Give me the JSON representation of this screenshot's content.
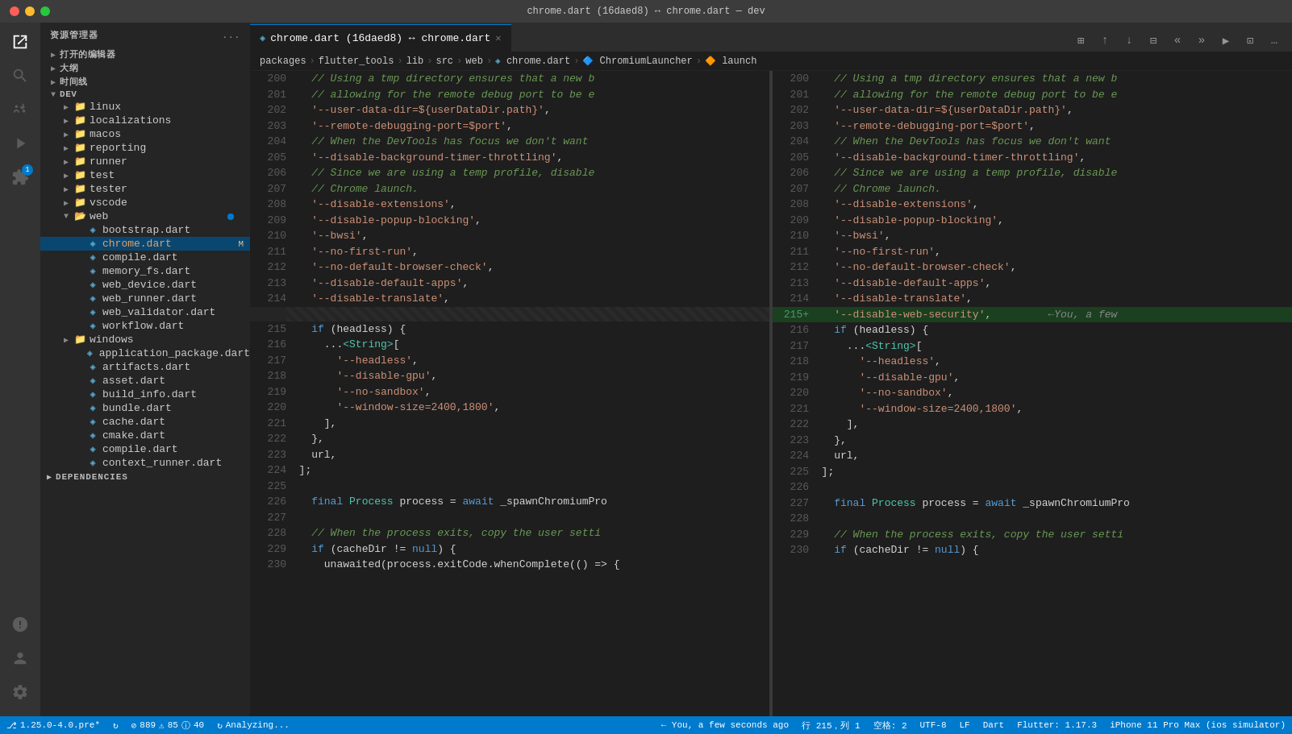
{
  "titleBar": {
    "title": "chrome.dart (16daed8) ↔ chrome.dart — dev"
  },
  "activityBar": {
    "icons": [
      {
        "name": "explorer-icon",
        "symbol": "⎗",
        "active": true,
        "badge": null
      },
      {
        "name": "search-icon",
        "symbol": "🔍",
        "active": false
      },
      {
        "name": "source-control-icon",
        "symbol": "⑂",
        "active": false
      },
      {
        "name": "run-icon",
        "symbol": "▷",
        "active": false
      },
      {
        "name": "extensions-icon",
        "symbol": "⊞",
        "active": false
      },
      {
        "name": "remote-icon",
        "symbol": "◎",
        "active": false,
        "badge": "1"
      }
    ],
    "bottomIcons": [
      {
        "name": "problems-icon",
        "symbol": "⚠"
      },
      {
        "name": "account-icon",
        "symbol": "👤"
      },
      {
        "name": "settings-icon",
        "symbol": "⚙"
      }
    ]
  },
  "sidebar": {
    "header": "资源管理器",
    "moreBtn": "...",
    "sections": [
      {
        "label": "打开的编辑器",
        "expanded": false,
        "indent": 0
      },
      {
        "label": "大纲",
        "expanded": false,
        "indent": 0
      },
      {
        "label": "时间线",
        "expanded": false,
        "indent": 0
      },
      {
        "label": "DEV",
        "expanded": true,
        "indent": 0,
        "children": [
          {
            "label": "linux",
            "type": "folder",
            "indent": 1,
            "expanded": false
          },
          {
            "label": "localizations",
            "type": "folder",
            "indent": 1,
            "expanded": false
          },
          {
            "label": "macos",
            "type": "folder",
            "indent": 1,
            "expanded": false
          },
          {
            "label": "reporting",
            "type": "folder",
            "indent": 1,
            "expanded": false
          },
          {
            "label": "runner",
            "type": "folder",
            "indent": 1,
            "expanded": false
          },
          {
            "label": "test",
            "type": "folder",
            "indent": 1,
            "expanded": false
          },
          {
            "label": "tester",
            "type": "folder",
            "indent": 1,
            "expanded": false
          },
          {
            "label": "vscode",
            "type": "folder",
            "indent": 1,
            "expanded": false
          },
          {
            "label": "web",
            "type": "folder",
            "indent": 1,
            "expanded": true,
            "dot": true,
            "children": [
              {
                "label": "bootstrap.dart",
                "type": "file",
                "indent": 2,
                "active": false
              },
              {
                "label": "chrome.dart",
                "type": "file",
                "indent": 2,
                "active": true,
                "badge": "M"
              },
              {
                "label": "compile.dart",
                "type": "file",
                "indent": 2
              },
              {
                "label": "memory_fs.dart",
                "type": "file",
                "indent": 2
              },
              {
                "label": "web_device.dart",
                "type": "file",
                "indent": 2
              },
              {
                "label": "web_runner.dart",
                "type": "file",
                "indent": 2
              },
              {
                "label": "web_validator.dart",
                "type": "file",
                "indent": 2
              },
              {
                "label": "workflow.dart",
                "type": "file",
                "indent": 2
              }
            ]
          },
          {
            "label": "windows",
            "type": "folder",
            "indent": 1,
            "expanded": false
          },
          {
            "label": "application_package.dart",
            "type": "file",
            "indent": 1
          },
          {
            "label": "artifacts.dart",
            "type": "file",
            "indent": 1
          },
          {
            "label": "asset.dart",
            "type": "file",
            "indent": 1
          },
          {
            "label": "build_info.dart",
            "type": "file",
            "indent": 1
          },
          {
            "label": "bundle.dart",
            "type": "file",
            "indent": 1
          },
          {
            "label": "cache.dart",
            "type": "file",
            "indent": 1
          },
          {
            "label": "cmake.dart",
            "type": "file",
            "indent": 1
          },
          {
            "label": "compile.dart",
            "type": "file",
            "indent": 1
          },
          {
            "label": "context_runner.dart",
            "type": "file",
            "indent": 1
          }
        ]
      }
    ],
    "dependencies": {
      "label": "DEPENDENCIES",
      "expanded": false
    }
  },
  "tabs": [
    {
      "label": "chrome.dart (16daed8) ↔ chrome.dart",
      "active": true,
      "dirty": false
    }
  ],
  "breadcrumb": {
    "parts": [
      "packages",
      "flutter_tools",
      "lib",
      "src",
      "web",
      "chrome.dart",
      "ChromiumLauncher",
      "launch"
    ]
  },
  "leftPane": {
    "lines": [
      {
        "num": 200,
        "content": "    // Using a tmp directory ensures that a new b",
        "type": "cmt"
      },
      {
        "num": 201,
        "content": "    // allowing for the remote debug port to be e",
        "type": "cmt"
      },
      {
        "num": 202,
        "content": "    '--user-data-dir=${userDataDir.path}',",
        "type": "str"
      },
      {
        "num": 203,
        "content": "    '--remote-debugging-port=$port',",
        "type": "str"
      },
      {
        "num": 204,
        "content": "    // When the DevTools has focus we don't want",
        "type": "cmt"
      },
      {
        "num": 205,
        "content": "    '--disable-background-timer-throttling',",
        "type": "str"
      },
      {
        "num": 206,
        "content": "    // Since we are using a temp profile, disable",
        "type": "cmt"
      },
      {
        "num": 207,
        "content": "    // Chrome launch.",
        "type": "cmt"
      },
      {
        "num": 208,
        "content": "    '--disable-extensions',",
        "type": "str"
      },
      {
        "num": 209,
        "content": "    '--disable-popup-blocking',",
        "type": "str"
      },
      {
        "num": 210,
        "content": "    '--bwsi',",
        "type": "str"
      },
      {
        "num": 211,
        "content": "    '--no-first-run',",
        "type": "str"
      },
      {
        "num": 212,
        "content": "    '--no-default-browser-check',",
        "type": "str"
      },
      {
        "num": 213,
        "content": "    '--disable-default-apps',",
        "type": "str"
      },
      {
        "num": 214,
        "content": "    '--disable-translate',",
        "type": "str"
      },
      {
        "num": "───",
        "content": "",
        "type": "separator"
      },
      {
        "num": 215,
        "content": "    if (headless) {",
        "type": "code"
      },
      {
        "num": 216,
        "content": "      ...<String>[",
        "type": "code"
      },
      {
        "num": 217,
        "content": "        '--headless',",
        "type": "str"
      },
      {
        "num": 218,
        "content": "        '--disable-gpu',",
        "type": "str"
      },
      {
        "num": 219,
        "content": "        '--no-sandbox',",
        "type": "str"
      },
      {
        "num": 220,
        "content": "        '--window-size=2400,1800',",
        "type": "str"
      },
      {
        "num": 221,
        "content": "      ],",
        "type": "code"
      },
      {
        "num": 222,
        "content": "    },",
        "type": "code"
      },
      {
        "num": 223,
        "content": "    url,",
        "type": "code"
      },
      {
        "num": 224,
        "content": "  ];",
        "type": "code"
      },
      {
        "num": 225,
        "content": "",
        "type": "code"
      },
      {
        "num": 226,
        "content": "    final Process process = await _spawnChromiumPro",
        "type": "code"
      },
      {
        "num": 227,
        "content": "",
        "type": "code"
      },
      {
        "num": 228,
        "content": "    // When the process exits, copy the user setti",
        "type": "cmt"
      },
      {
        "num": 229,
        "content": "    if (cacheDir != null) {",
        "type": "code"
      },
      {
        "num": 230,
        "content": "      unawaited(process.exitCode.whenComplete(() => {",
        "type": "code"
      }
    ]
  },
  "rightPane": {
    "lines": [
      {
        "num": 200,
        "content": "    // Using a tmp directory ensures that a new b",
        "type": "cmt"
      },
      {
        "num": 201,
        "content": "    // allowing for the remote debug port to be e",
        "type": "cmt"
      },
      {
        "num": 202,
        "content": "    '--user-data-dir=${userDataDir.path}',",
        "type": "str"
      },
      {
        "num": 203,
        "content": "    '--remote-debugging-port=$port',",
        "type": "str"
      },
      {
        "num": 204,
        "content": "    // When the DevTools has focus we don't want",
        "type": "cmt"
      },
      {
        "num": 205,
        "content": "    '--disable-background-timer-throttling',",
        "type": "str"
      },
      {
        "num": 206,
        "content": "    // Since we are using a temp profile, disable",
        "type": "cmt"
      },
      {
        "num": 207,
        "content": "    // Chrome launch.",
        "type": "cmt"
      },
      {
        "num": 208,
        "content": "    '--disable-extensions',",
        "type": "str"
      },
      {
        "num": 209,
        "content": "    '--disable-popup-blocking',",
        "type": "str"
      },
      {
        "num": 210,
        "content": "    '--bwsi',",
        "type": "str"
      },
      {
        "num": 211,
        "content": "    '--no-first-run',",
        "type": "str"
      },
      {
        "num": 212,
        "content": "    '--no-default-browser-check',",
        "type": "str"
      },
      {
        "num": 213,
        "content": "    '--disable-default-apps',",
        "type": "str"
      },
      {
        "num": 214,
        "content": "    '--disable-translate',",
        "type": "str"
      },
      {
        "num": "215+",
        "content": "    '--disable-web-security',         ←You, a few",
        "type": "added"
      },
      {
        "num": 216,
        "content": "    if (headless) {",
        "type": "code"
      },
      {
        "num": 217,
        "content": "      ...<String>[",
        "type": "code"
      },
      {
        "num": 218,
        "content": "        '--headless',",
        "type": "str"
      },
      {
        "num": 219,
        "content": "        '--disable-gpu',",
        "type": "str"
      },
      {
        "num": 220,
        "content": "        '--no-sandbox',",
        "type": "str"
      },
      {
        "num": 221,
        "content": "        '--window-size=2400,1800',",
        "type": "str"
      },
      {
        "num": 222,
        "content": "      ],",
        "type": "code"
      },
      {
        "num": 223,
        "content": "    },",
        "type": "code"
      },
      {
        "num": 224,
        "content": "    url,",
        "type": "code"
      },
      {
        "num": 225,
        "content": "  ];",
        "type": "code"
      },
      {
        "num": 226,
        "content": "",
        "type": "code"
      },
      {
        "num": 227,
        "content": "    final Process process = await _spawnChromiumPro",
        "type": "code"
      },
      {
        "num": 228,
        "content": "",
        "type": "code"
      },
      {
        "num": 229,
        "content": "    // When the process exits, copy the user setti",
        "type": "cmt"
      },
      {
        "num": 230,
        "content": "    if (cacheDir != null) {",
        "type": "code"
      }
    ]
  },
  "statusBar": {
    "left": [
      {
        "id": "branch",
        "text": "⎇ 1.25.0-4.0.pre*"
      },
      {
        "id": "sync",
        "text": "↻"
      },
      {
        "id": "errors",
        "text": "⊘ 889 ⚠ 85 ⊙ 40"
      },
      {
        "id": "analyzing",
        "text": "↻ Analyzing..."
      }
    ],
    "right": [
      {
        "id": "cursor-pos",
        "text": "← You, a few seconds ago"
      },
      {
        "id": "line-col",
        "text": "行 215，列 1"
      },
      {
        "id": "spaces",
        "text": "空格: 2"
      },
      {
        "id": "encoding",
        "text": "UTF-8"
      },
      {
        "id": "eol",
        "text": "LF"
      },
      {
        "id": "language",
        "text": "Dart"
      },
      {
        "id": "flutter",
        "text": "Flutter: 1.17.3"
      },
      {
        "id": "device",
        "text": "iPhone 11 Pro Max (ios simulator)"
      }
    ]
  }
}
